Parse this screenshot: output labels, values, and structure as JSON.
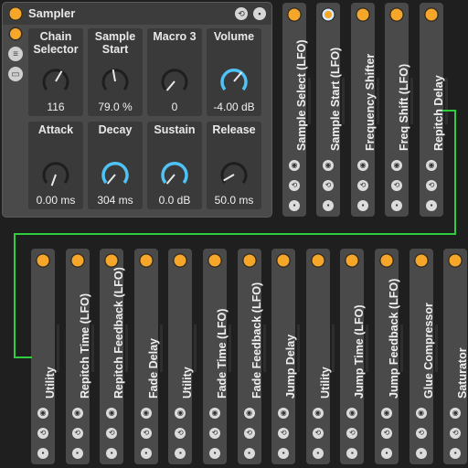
{
  "device": {
    "title": "Sampler"
  },
  "macros": [
    {
      "label": "Chain Selector",
      "value": "116",
      "style": "gray"
    },
    {
      "label": "Sample Start",
      "value": "79.0 %",
      "style": "gray"
    },
    {
      "label": "Macro 3",
      "value": "0",
      "style": "gray"
    },
    {
      "label": "Volume",
      "value": "-4.00 dB",
      "style": "blue"
    },
    {
      "label": "Attack",
      "value": "0.00 ms",
      "style": "gray"
    },
    {
      "label": "Decay",
      "value": "304 ms",
      "style": "blue"
    },
    {
      "label": "Sustain",
      "value": "0.0 dB",
      "style": "blue"
    },
    {
      "label": "Release",
      "value": "50.0 ms",
      "style": "gray"
    }
  ],
  "row1_devices": [
    {
      "label": "Sample Select (LFO)",
      "selected": false
    },
    {
      "label": "Sample Start (LFO)",
      "selected": true
    },
    {
      "label": "Frequency Shifter",
      "selected": false
    },
    {
      "label": "Freq Shift (LFO)",
      "selected": false
    },
    {
      "label": "Repitch Delay",
      "selected": false
    }
  ],
  "row2_devices": [
    {
      "label": "Utility"
    },
    {
      "label": "Repitch Time (LFO)"
    },
    {
      "label": "Repitch Feedback (LFO)"
    },
    {
      "label": "Fade Delay"
    },
    {
      "label": "Utility"
    },
    {
      "label": "Fade Time (LFO)"
    },
    {
      "label": "Fade Feedback (LFO)"
    },
    {
      "label": "Jump Delay"
    },
    {
      "label": "Utility"
    },
    {
      "label": "Jump Time (LFO)"
    },
    {
      "label": "Jump Feedback (LFO)"
    },
    {
      "label": "Glue Compressor"
    },
    {
      "label": "Saturator"
    }
  ],
  "colors": {
    "accent": "#f6a628",
    "knob_blue": "#4fc3f7",
    "wire": "#2ecc3f"
  },
  "icons": {
    "power": "power-icon",
    "hot_swap": "hot-swap-icon",
    "save": "save-icon",
    "map": "map-icon",
    "chain": "chain-icon",
    "list": "list-icon"
  }
}
